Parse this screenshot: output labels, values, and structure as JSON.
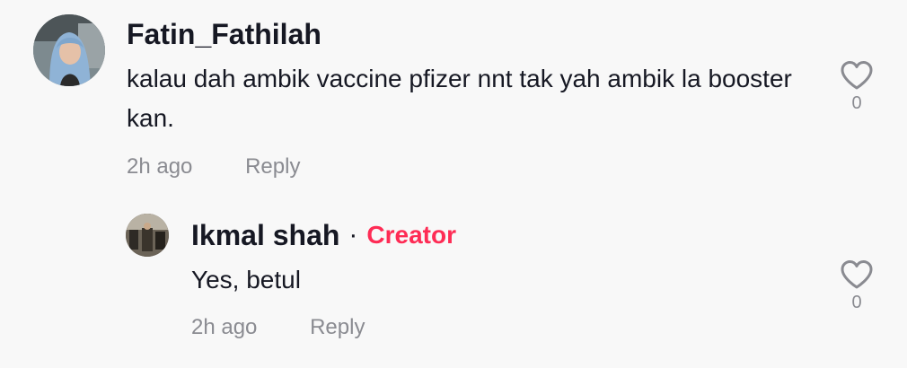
{
  "comment": {
    "username": "Fatin_Fathilah",
    "text": "kalau dah ambik vaccine pfizer nnt tak yah ambik la booster kan.",
    "time": "2h ago",
    "reply_label": "Reply",
    "like_count": "0",
    "like_icon": "heart-outline-icon"
  },
  "reply": {
    "username": "Ikmal shah",
    "separator": "·",
    "badge": "Creator",
    "text": "Yes, betul",
    "time": "2h ago",
    "reply_label": "Reply",
    "like_count": "0",
    "like_icon": "heart-outline-icon"
  },
  "colors": {
    "background": "#f8f8f8",
    "text": "#161823",
    "secondary": "#8a8b91",
    "creator_badge": "#fe2c55"
  }
}
